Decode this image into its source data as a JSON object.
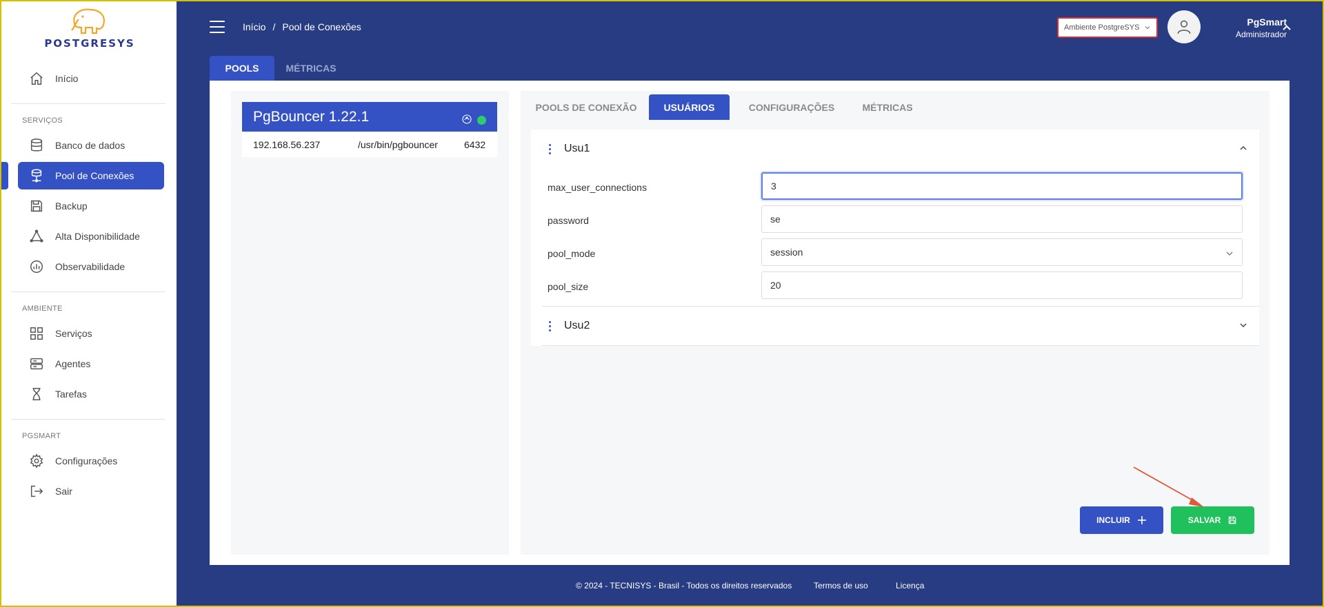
{
  "logo": {
    "text": "POSTGRESYS"
  },
  "sidebar": {
    "home_label": "Início",
    "sections": [
      {
        "label": "SERVIÇOS",
        "items": [
          {
            "label": "Banco de dados",
            "icon": "database-icon"
          },
          {
            "label": "Pool de Conexões",
            "icon": "connection-pool-icon",
            "active": true
          },
          {
            "label": "Backup",
            "icon": "save-icon"
          },
          {
            "label": "Alta Disponibilidade",
            "icon": "triangle-network-icon"
          },
          {
            "label": "Observabilidade",
            "icon": "chart-circle-icon"
          }
        ]
      },
      {
        "label": "AMBIENTE",
        "items": [
          {
            "label": "Serviços",
            "icon": "grid-icon"
          },
          {
            "label": "Agentes",
            "icon": "server-icon"
          },
          {
            "label": "Tarefas",
            "icon": "hourglass-icon"
          }
        ]
      },
      {
        "label": "PGSMART",
        "items": [
          {
            "label": "Configurações",
            "icon": "gear-icon"
          },
          {
            "label": "Sair",
            "icon": "logout-icon"
          }
        ]
      }
    ]
  },
  "header": {
    "breadcrumb": [
      "Início",
      "/",
      "Pool de Conexões"
    ],
    "environment": "Ambiente PostgreSYS",
    "user": {
      "name": "PgSmart",
      "role": "Administrador"
    }
  },
  "top_tabs": [
    "POOLS",
    "MÉTRICAS"
  ],
  "pool": {
    "title": "PgBouncer 1.22.1",
    "status_color": "#2ecc71",
    "host": "192.168.56.237",
    "path": "/usr/bin/pgbouncer",
    "port": "6432"
  },
  "sub_tabs": [
    "POOLS DE CONEXÃO",
    "USUÁRIOS",
    "CONFIGURAÇÕES",
    "MÉTRICAS"
  ],
  "users": [
    {
      "name": "Usu1",
      "expanded": true,
      "fields": [
        {
          "label": "max_user_connections",
          "value": "3"
        },
        {
          "label": "password",
          "value": "se"
        },
        {
          "label": "pool_mode",
          "value": "session"
        },
        {
          "label": "pool_size",
          "value": "20"
        }
      ]
    },
    {
      "name": "Usu2",
      "expanded": false
    }
  ],
  "actions": {
    "include": "INCLUIR",
    "save": "SALVAR"
  },
  "footer": {
    "copyright": "© 2024 - TECNISYS - Brasil - Todos os direitos reservados",
    "terms": "Termos de uso",
    "license": "Licença"
  },
  "colors": {
    "primary": "#3452c4",
    "header_bg": "#283c84",
    "success": "#20c05c",
    "annotation_arrow": "#e05a3a"
  }
}
